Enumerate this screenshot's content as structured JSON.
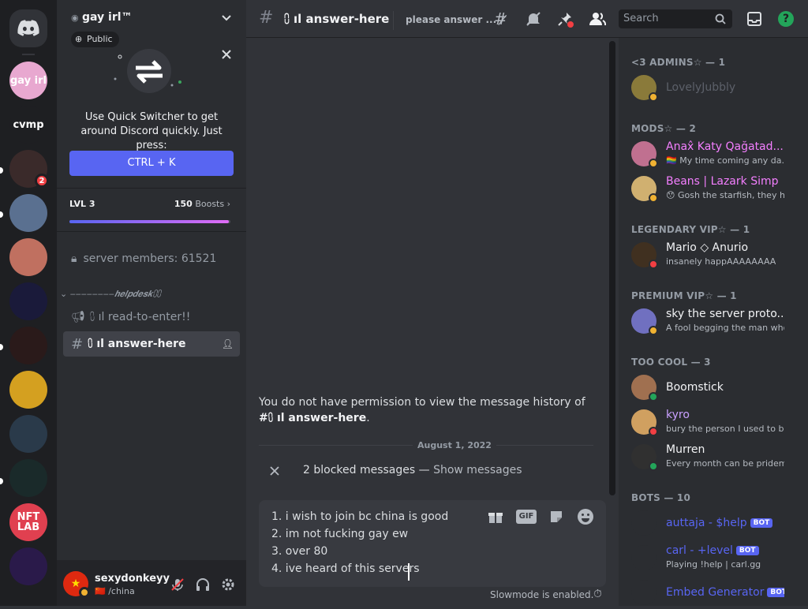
{
  "server_rail": {
    "home_icon": "discord-logo-icon",
    "servers": [
      {
        "label": "gay irl",
        "color": "#e8a8d0"
      },
      {
        "label": "cvmp",
        "color": "#1e1f22"
      },
      {
        "label": "",
        "color": "#3a2a2a",
        "badge": "2"
      },
      {
        "label": "",
        "color": "#5a7090"
      },
      {
        "label": "",
        "color": "#c07060"
      },
      {
        "label": "",
        "color": "#1a1a3a"
      },
      {
        "label": "",
        "color": "#2a1a1a"
      },
      {
        "label": "",
        "color": "#d4a020"
      },
      {
        "label": "",
        "color": "#2a3a4a"
      },
      {
        "label": "",
        "color": "#1a2a2a"
      },
      {
        "label": "NFT LAB",
        "color": "#e04050"
      },
      {
        "label": "",
        "color": "#2a1a4a"
      }
    ]
  },
  "sidebar": {
    "server_name": "gay irl™",
    "public_label": "Public",
    "quick_switcher_text": "Use Quick Switcher to get around Discord quickly. Just press:",
    "quick_switcher_key": "CTRL + K",
    "boost_level": "LVL 3",
    "boost_count": "150",
    "boost_label": "Boosts",
    "boost_progress": 0.99,
    "member_count_channel": "server members: 61521",
    "category": "‒‒‒‒‒‒‒‒𝒉𝒆𝒍𝒑𝒅𝒆𝒔𝒌⩇⩇",
    "channels": [
      {
        "name": "⩇ ıl read-to-enter!!",
        "icon": "megaphone-icon"
      },
      {
        "name": "⩇ ıl answer-here",
        "icon": "hash-icon",
        "active": true
      }
    ]
  },
  "user_panel": {
    "username": "sexydonkeyy",
    "status": "/china",
    "status_flag": "🇨🇳"
  },
  "header": {
    "channel_name": "⩇ ıl answer-here",
    "topic": "please answer ...",
    "search_placeholder": "Search"
  },
  "chat": {
    "no_permission_prefix": "You do not have permission to view the message history of ",
    "no_permission_channel": "#⩇ ıl answer-here",
    "date_divider": "August 1, 2022",
    "blocked_text": "2 blocked messages",
    "blocked_sep": " — ",
    "blocked_action": "Show messages",
    "input_lines": [
      "1. i wish to join bc china is good",
      "2. im not fucking gay ew",
      "3. over 80",
      "4. ive heard of this servers"
    ],
    "gif_label": "GIF",
    "slowmode_text": "Slowmode is enabled."
  },
  "members": {
    "groups": [
      {
        "title": "<3 ADMINS☆ — 1",
        "members": [
          {
            "name": "LovelyJubbly",
            "sub": "",
            "color": "#5c6069",
            "status": "idle",
            "av": "#8a7a3a"
          }
        ]
      },
      {
        "title": "MODS☆ — 2",
        "members": [
          {
            "name": "Anax̂ Katy Qağatad...",
            "sub": "My time coming any da...",
            "sub_icon": "🏳️‍🌈",
            "color": "#f47fff",
            "status": "idle",
            "av": "#c07090"
          },
          {
            "name": "Beans | Lazark Simp",
            "sub": "Gosh the starfish, they hav...",
            "sub_icon": "😯",
            "color": "#f47fff",
            "status": "idle",
            "av": "#d0b070"
          }
        ]
      },
      {
        "title": "LEGENDARY VIP☆ — 1",
        "members": [
          {
            "name": "Mario ◇ Anurio",
            "sub": "insanely happAAAAAAAA",
            "color": "#f2f3f5",
            "status": "dnd",
            "av": "#403020"
          }
        ]
      },
      {
        "title": "PREMIUM VIP☆ — 1",
        "members": [
          {
            "name": "sky the server proto...",
            "sub": "A fool begging the man who c...",
            "color": "#f2f3f5",
            "status": "idle",
            "av": "#7070c0"
          }
        ]
      },
      {
        "title": "TOO COOL — 3",
        "members": [
          {
            "name": "Boomstick",
            "sub": "",
            "color": "#f2f3f5",
            "status": "mobile",
            "av": "#a07050"
          },
          {
            "name": "kyro",
            "sub": "bury the person I used to be m...",
            "color": "#c9a0ff",
            "status": "dnd",
            "av": "#d0a060"
          },
          {
            "name": "Murren",
            "sub": "Every month can be pridem...",
            "color": "#f2f3f5",
            "status": "online",
            "av": "#303030"
          }
        ]
      },
      {
        "title": "BOTS — 10",
        "members": [
          {
            "name": "auttaja - $help",
            "sub": "",
            "bot": "BOT",
            "color": "#5865f2",
            "status": "",
            "av": "#2b2d31"
          },
          {
            "name": "carl - +level",
            "sub": "Playing !help | carl.gg",
            "bot": "BOT",
            "color": "#5865f2",
            "status": "",
            "av": "#2b2d31"
          },
          {
            "name": "Embed Generator",
            "sub": "",
            "bot": "BOT",
            "color": "#5865f2",
            "status": "",
            "av": "#2b2d31"
          }
        ]
      }
    ]
  }
}
